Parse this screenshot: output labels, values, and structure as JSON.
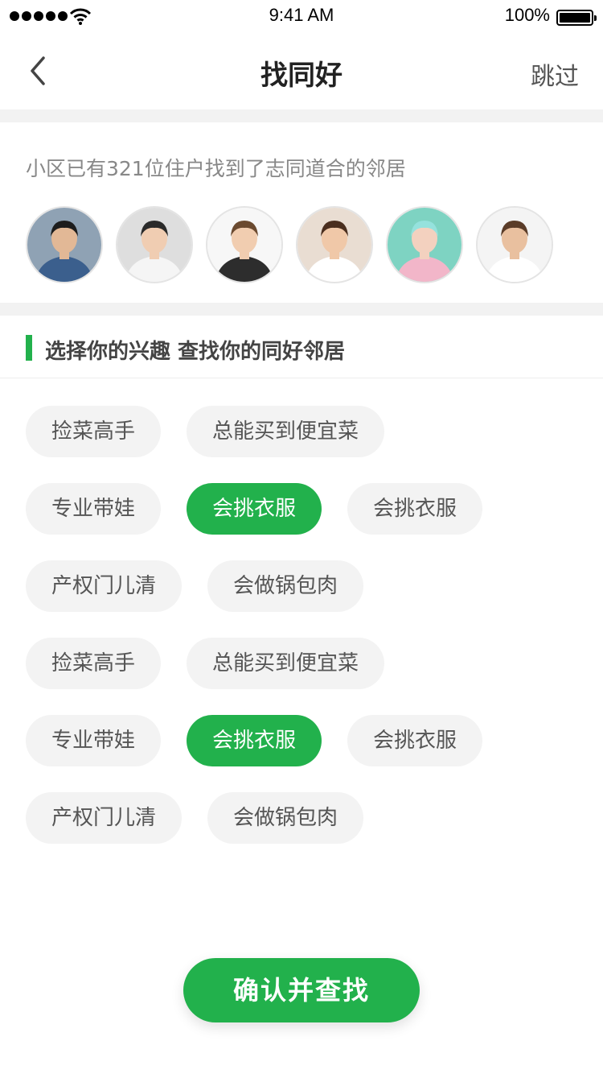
{
  "status_bar": {
    "time": "9:41 AM",
    "battery_percent": "100%",
    "battery_level": 1.0
  },
  "nav": {
    "title": "找同好",
    "skip_label": "跳过",
    "back_icon": "chevron-left-icon"
  },
  "residents": {
    "text": "小区已有321位住户找到了志同道合的邻居",
    "avatars": [
      {
        "name": "avatar-1",
        "bg": "#8fa2b4",
        "skin": "#e2b896",
        "hair": "#1d1d1d",
        "shirt": "#3b5f8d"
      },
      {
        "name": "avatar-2",
        "bg": "#dedede",
        "skin": "#f0cdb2",
        "hair": "#2a2a2a",
        "shirt": "#f5f5f5"
      },
      {
        "name": "avatar-3",
        "bg": "#f7f7f7",
        "skin": "#f1cdb0",
        "hair": "#6b4a30",
        "shirt": "#2d2d2d"
      },
      {
        "name": "avatar-4",
        "bg": "#e9ddd2",
        "skin": "#f0c8a8",
        "hair": "#4a2e1e",
        "shirt": "#ffffff"
      },
      {
        "name": "avatar-5",
        "bg": "#7ed3c2",
        "skin": "#f3d1bf",
        "hair": "#95e2dd",
        "shirt": "#f2b6c9"
      },
      {
        "name": "avatar-6",
        "bg": "#f4f4f4",
        "skin": "#e9c09f",
        "hair": "#5a3c28",
        "shirt": "#ffffff"
      }
    ]
  },
  "interests": {
    "title": "选择你的兴趣 查找你的同好邻居",
    "accent_color": "#22b14c",
    "rows": [
      [
        {
          "label": "捡菜高手",
          "active": false
        },
        {
          "label": "总能买到便宜菜",
          "active": false
        }
      ],
      [
        {
          "label": "专业带娃",
          "active": false
        },
        {
          "label": "会挑衣服",
          "active": true
        },
        {
          "label": "会挑衣服",
          "active": false
        }
      ],
      [
        {
          "label": "产权门儿清",
          "active": false
        },
        {
          "label": "会做锅包肉",
          "active": false
        }
      ],
      [
        {
          "label": "捡菜高手",
          "active": false
        },
        {
          "label": "总能买到便宜菜",
          "active": false
        }
      ],
      [
        {
          "label": "专业带娃",
          "active": false
        },
        {
          "label": "会挑衣服",
          "active": true
        },
        {
          "label": "会挑衣服",
          "active": false
        }
      ],
      [
        {
          "label": "产权门儿清",
          "active": false
        },
        {
          "label": "会做锅包肉",
          "active": false
        }
      ]
    ]
  },
  "confirm": {
    "label": "确认并查找"
  }
}
